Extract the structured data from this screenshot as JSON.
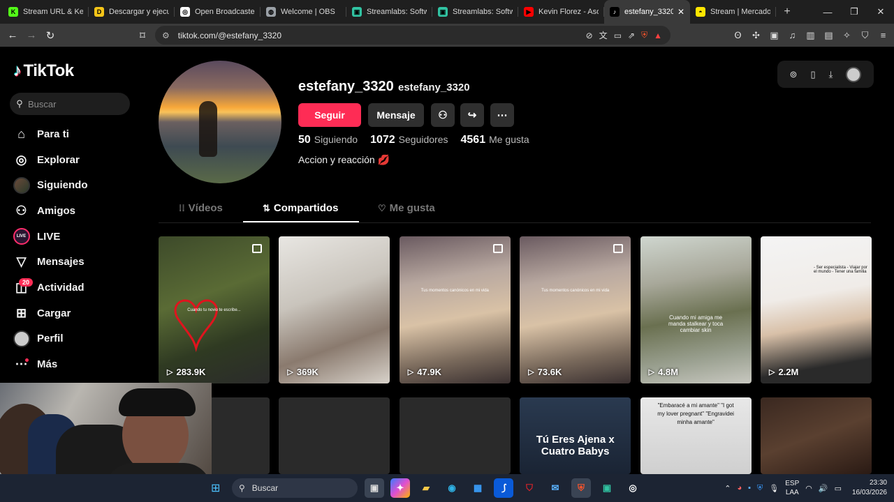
{
  "browser": {
    "tabs": [
      {
        "label": "Stream URL & Key",
        "fav_color": "#53fc18",
        "fav_glyph": "K"
      },
      {
        "label": "Descargar y ejecut",
        "fav_color": "#f5c518",
        "fav_glyph": "D"
      },
      {
        "label": "Open Broadcaster",
        "fav_color": "#ffffff",
        "fav_glyph": "◎"
      },
      {
        "label": "Welcome | OBS",
        "fav_color": "#9aa0a6",
        "fav_glyph": "◍"
      },
      {
        "label": "Streamlabs: Softw",
        "fav_color": "#31c3a2",
        "fav_glyph": "▣"
      },
      {
        "label": "Streamlabs: Softw",
        "fav_color": "#31c3a2",
        "fav_glyph": "▣"
      },
      {
        "label": "Kevin Florez - Aso",
        "fav_color": "#ff0000",
        "fav_glyph": "▶"
      },
      {
        "label": "estefany_3320",
        "fav_color": "#000000",
        "fav_glyph": "♪",
        "active": true
      },
      {
        "label": "Stream | Mercadol",
        "fav_color": "#ffe600",
        "fav_glyph": "◓"
      }
    ],
    "url": "tiktok.com/@estefany_3320"
  },
  "sidebar": {
    "logo": "TikTok",
    "search_placeholder": "Buscar",
    "items": [
      {
        "label": "Para ti",
        "icon": "home-icon"
      },
      {
        "label": "Explorar",
        "icon": "compass-icon"
      },
      {
        "label": "Siguiendo",
        "icon": "following-avatar"
      },
      {
        "label": "Amigos",
        "icon": "friends-icon"
      },
      {
        "label": "LIVE",
        "icon": "live-icon"
      },
      {
        "label": "Mensajes",
        "icon": "messages-icon"
      },
      {
        "label": "Actividad",
        "icon": "activity-icon",
        "badge": "20"
      },
      {
        "label": "Cargar",
        "icon": "upload-icon"
      },
      {
        "label": "Perfil",
        "icon": "profile-avatar"
      },
      {
        "label": "Más",
        "icon": "more-icon"
      }
    ]
  },
  "profile": {
    "username": "estefany_3320",
    "nickname": "estefany_3320",
    "follow_label": "Seguir",
    "message_label": "Mensaje",
    "following_count": "50",
    "following_label": "Siguiendo",
    "followers_count": "1072",
    "followers_label": "Seguidores",
    "likes_count": "4561",
    "likes_label": "Me gusta",
    "bio": "Accion y reacción",
    "bio_emoji": "💋"
  },
  "profile_tabs": [
    {
      "label": "Vídeos",
      "glyph": "⁞⁞"
    },
    {
      "label": "Compartidos",
      "glyph": "⇅",
      "active": true
    },
    {
      "label": "Me gusta",
      "glyph": "♡"
    }
  ],
  "videos": [
    {
      "views": "283.9K",
      "pinned": true,
      "caption": "Cuando tu novio te escribe...",
      "bg": "linear-gradient(160deg,#3d4a2a,#5a6b35 40%,#2f3a22 70%,#2b2b2b)"
    },
    {
      "views": "369K",
      "pinned": false,
      "caption": "",
      "bg": "linear-gradient(160deg,#e8e6e2,#c9c4bc 40%,#8a7a6e 70%,#d8d2ca)"
    },
    {
      "views": "47.9K",
      "pinned": true,
      "caption": "Tus momentos canónicos en mi vida",
      "bg": "linear-gradient(170deg,#6a5a60,#b8a8a0 30%,#d9c2a6 55%,#7a6a5c 80%,#3a3030)"
    },
    {
      "views": "73.6K",
      "pinned": true,
      "caption": "Tus momentos canónicos en mi vida",
      "bg": "linear-gradient(170deg,#6a5a60,#b8a8a0 30%,#d9c2a6 55%,#7a6a5c 80%,#3a3030)"
    },
    {
      "views": "4.8M",
      "pinned": false,
      "caption": "Cuando mi amiga me manda stalkear y toca cambiar skin",
      "bg": "linear-gradient(170deg,#cfd6cf,#a8a89a 30%,#6a7050 55%,#9aa090 80%,#c8c8c0)"
    },
    {
      "views": "2.2M",
      "pinned": false,
      "caption": "- Ser especialista - Viajar por el mundo - Tener una familia",
      "bg": "linear-gradient(170deg,#f4f4f4,#f0ece8 40%,#d8c0a8 60%,#2a2a2a 85%)"
    }
  ],
  "videos_row2": [
    {
      "caption": "",
      "bg": "#2a2a2a"
    },
    {
      "caption": "",
      "bg": "#2a2a2a"
    },
    {
      "caption": "",
      "bg": "#2a2a2a"
    },
    {
      "caption": "Tú Eres Ajena x Cuatro Babys",
      "bg": "linear-gradient(180deg,#2a3a50,#1a2434)"
    },
    {
      "caption": "\"Embaracé a mi amante\" \"I got my lover pregnant\" \"Engravidei minha amante\"",
      "bg": "linear-gradient(180deg,#e8e8e8,#cfcfcf)"
    },
    {
      "caption": "",
      "bg": "linear-gradient(160deg,#3a2820,#5a4030 50%,#2a1a14)"
    }
  ],
  "taskbar": {
    "search_placeholder": "Buscar",
    "lang_top": "ESP",
    "lang_bottom": "LAA",
    "time": "23:30",
    "date": "16/03/2026"
  }
}
